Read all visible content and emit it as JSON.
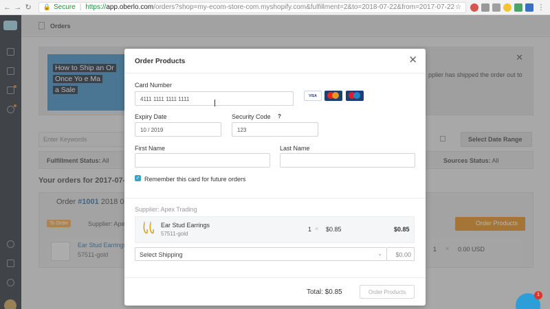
{
  "browser": {
    "secure_label": "Secure",
    "url_https": "https://",
    "url_host": "app.oberlo.com",
    "url_rest": "/orders?shop=my-ecom-store-com.myshopify.com&fulfillment=2&to=2018-07-22&from=2017-07-22"
  },
  "page": {
    "title": "Orders",
    "video_title_lines": [
      "How to Ship an Or",
      "Once Yo     e Ma",
      "a Sale"
    ],
    "banner_text": "pplier has shipped the order out to",
    "keyword_placeholder": "Enter Keywords",
    "date_range_label": "Select Date Range",
    "fulfillment_status_label": "Fulfillment Status:",
    "fulfillment_status_value": "All",
    "sources_status_label": "Sources Status:",
    "sources_status_value": "All",
    "orders_heading": "Your orders for 2017-07-22 -",
    "order_label": "Order",
    "order_number": "#1001",
    "order_date": "2018 07",
    "to_order_badge": "To Order",
    "supplier_label": "Supplier: Apex",
    "order_products_button": "Order Products",
    "bg_item_name": "Ear Stud Earrings",
    "bg_item_sku": "57511-gold",
    "bg_item_qty": "1",
    "bg_item_price": "0.00 USD"
  },
  "modal": {
    "title": "Order Products",
    "card_number_label": "Card Number",
    "card_number_value": "4111 1111 1111 1111",
    "card_brands": [
      "VISA",
      "MasterCard",
      "Maestro"
    ],
    "expiry_label": "Expiry Date",
    "expiry_value": "10 / 2019",
    "security_label": "Security Code",
    "security_help": "?",
    "security_value": "123",
    "first_name_label": "First Name",
    "first_name_value": "",
    "last_name_label": "Last Name",
    "last_name_value": "",
    "remember_label": "Remember this card for future orders",
    "remember_checked": true,
    "supplier": "Supplier: Apex Trading",
    "item": {
      "name": "Ear Stud Earrings",
      "sku": "57511-gold",
      "qty": "1",
      "unit_price": "$0.85",
      "line_total": "$0.85"
    },
    "shipping_label": "Select Shipping",
    "shipping_price": "$0.00",
    "total": "Total: $0.85",
    "order_button": "Order Products"
  },
  "chat": {
    "badge_count": "1"
  },
  "colors": {
    "accent": "#3aa3c4",
    "order_button_orange": "#e08a1a",
    "link_blue": "#2b6fa6",
    "sidebar": "#2b3137"
  }
}
